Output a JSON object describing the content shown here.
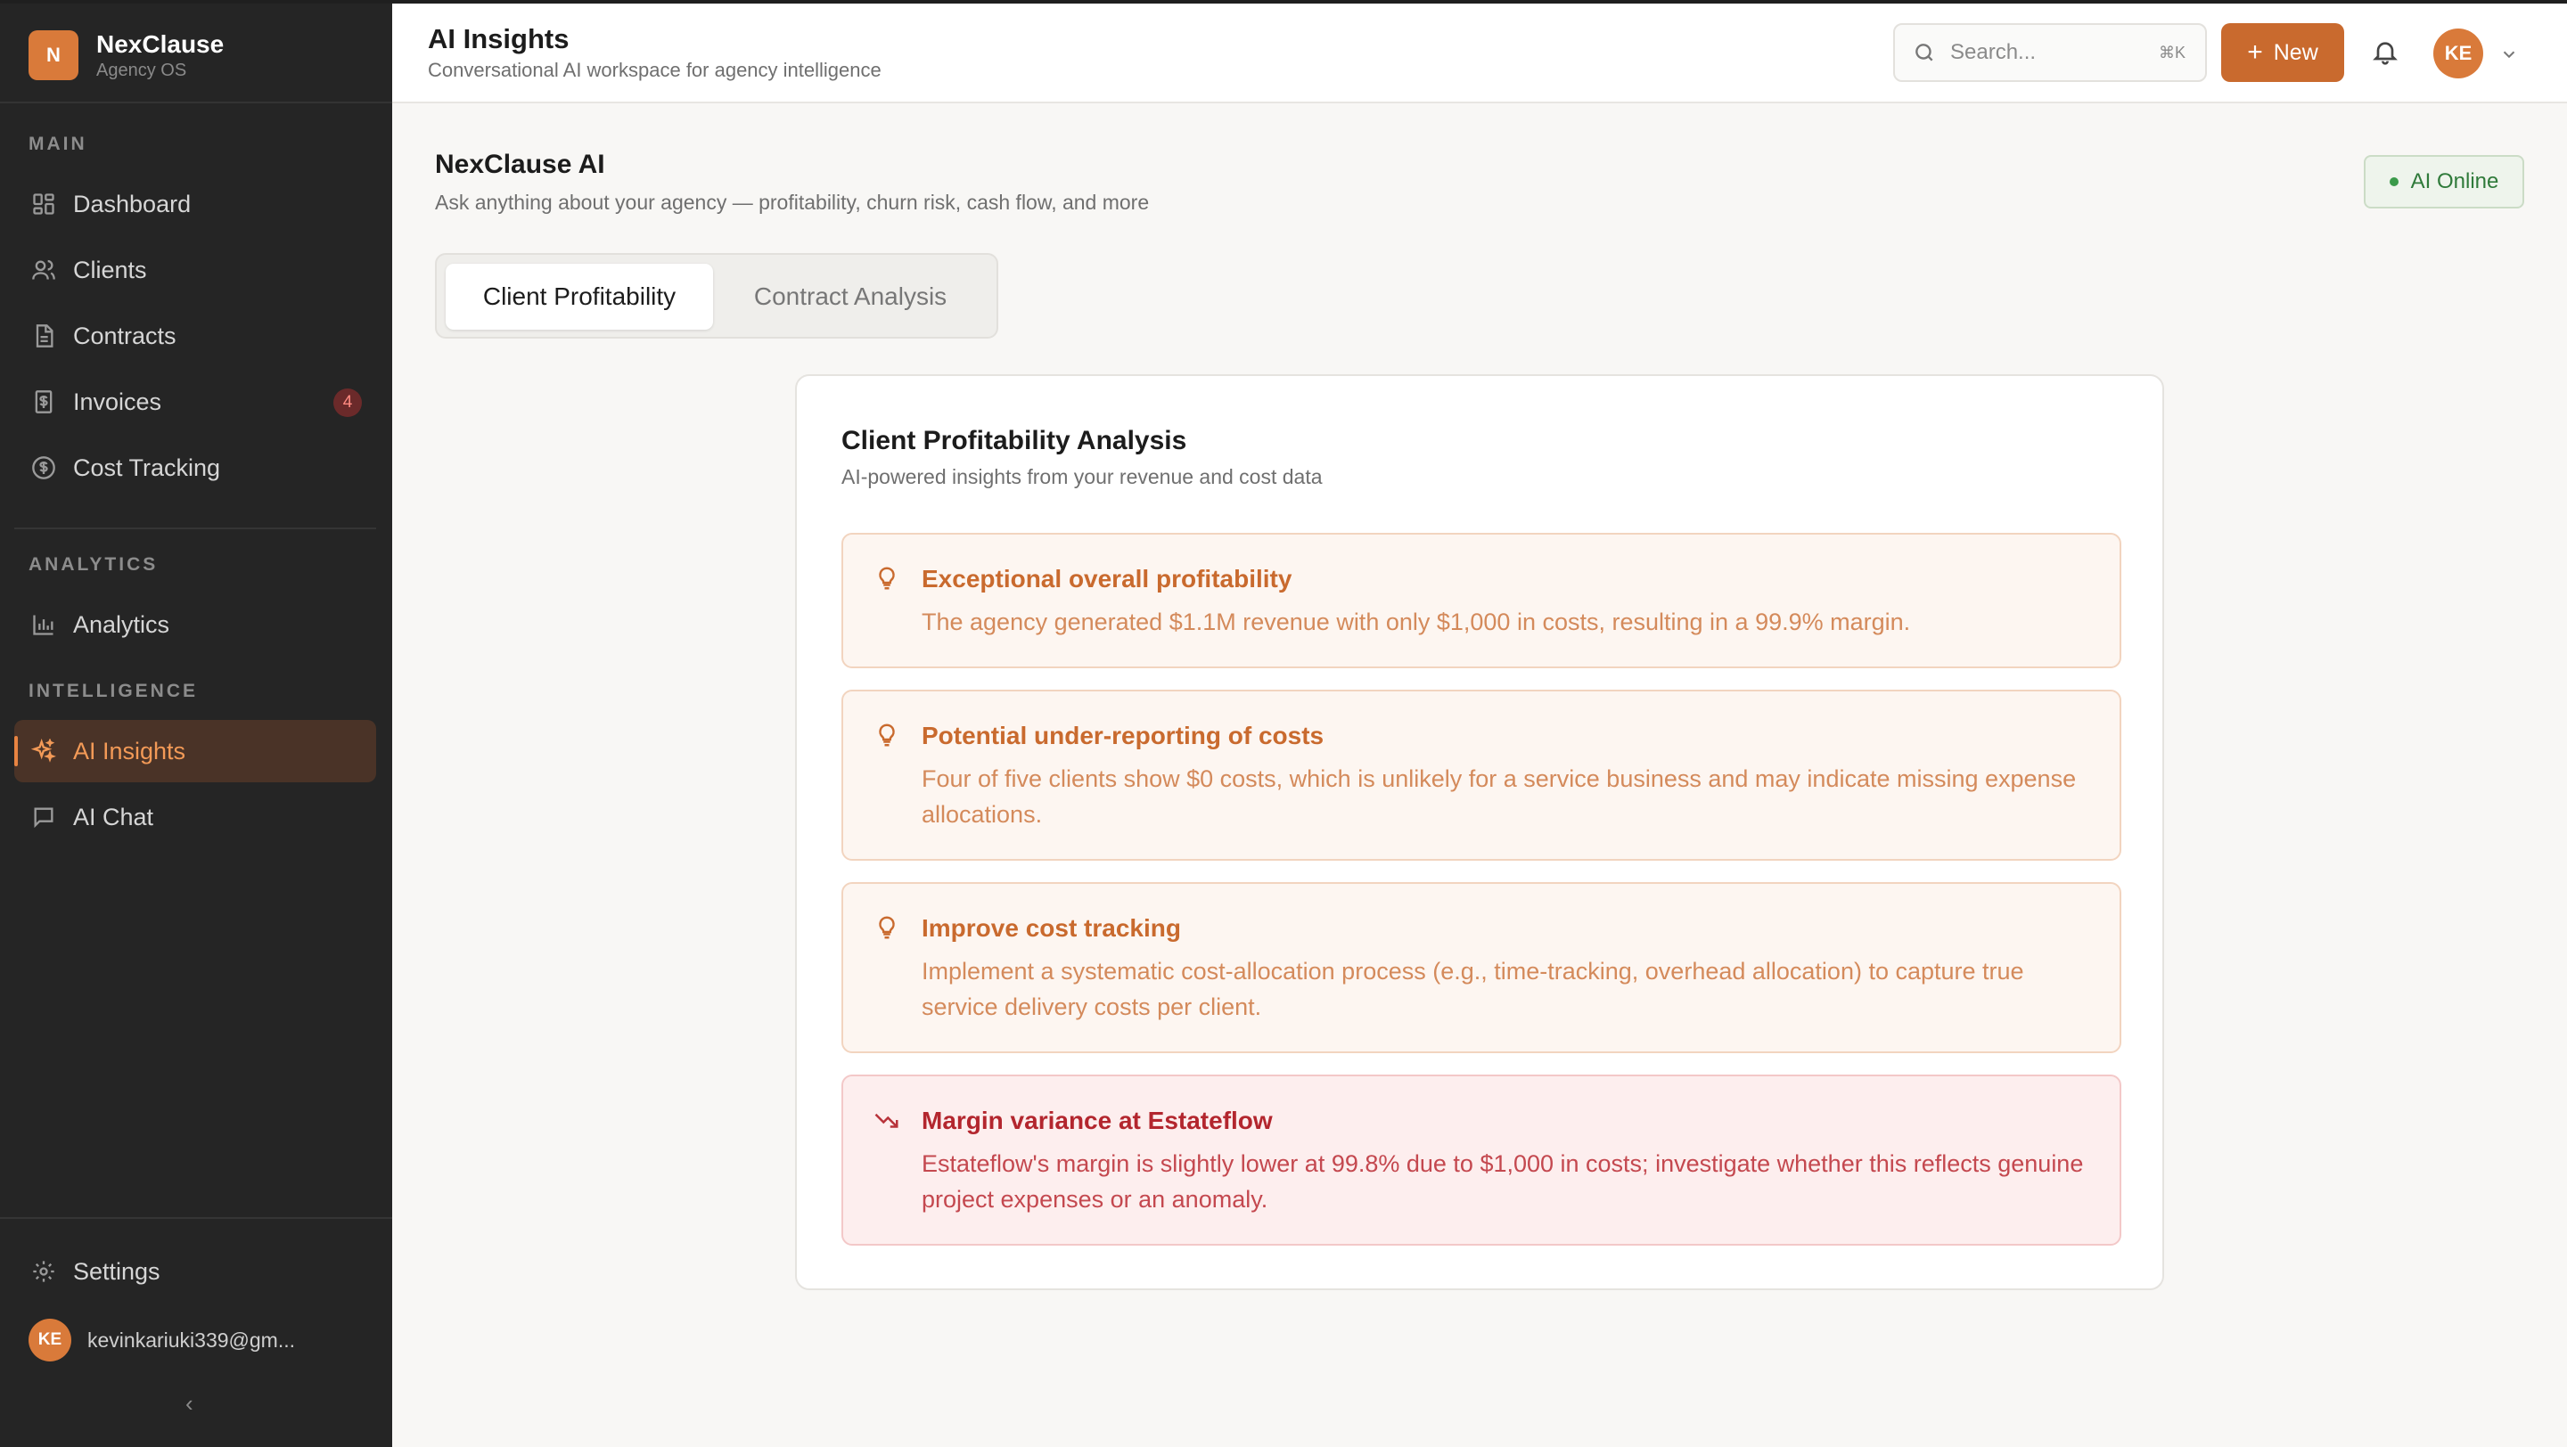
{
  "sidebar": {
    "brand": {
      "logo_letter": "N",
      "name": "NexClause",
      "subtitle": "Agency OS"
    },
    "sections": {
      "main": "MAIN",
      "analytics": "ANALYTICS",
      "intelligence": "INTELLIGENCE"
    },
    "items": {
      "dashboard": "Dashboard",
      "clients": "Clients",
      "contracts": "Contracts",
      "invoices": "Invoices",
      "invoices_badge": "4",
      "cost_tracking": "Cost Tracking",
      "analytics": "Analytics",
      "ai_insights": "AI Insights",
      "ai_chat": "AI Chat",
      "settings": "Settings"
    },
    "user": {
      "initials": "KE",
      "email": "kevinkariuki339@gm..."
    },
    "collapse_glyph": "‹"
  },
  "header": {
    "title": "AI Insights",
    "subtitle": "Conversational AI workspace for agency intelligence",
    "search_placeholder": "Search...",
    "search_shortcut": "⌘K",
    "new_label": "New",
    "avatar_initials": "KE"
  },
  "main": {
    "title": "NexClause AI",
    "subtitle": "Ask anything about your agency — profitability, churn risk, cash flow, and more",
    "status": "AI Online",
    "tabs": [
      "Client Profitability",
      "Contract Analysis"
    ],
    "card": {
      "title": "Client Profitability Analysis",
      "subtitle": "AI-powered insights from your revenue and cost data",
      "insights": [
        {
          "icon": "lightbulb-icon",
          "title": "Exceptional overall profitability",
          "body": "The agency generated $1.1M revenue with only $1,000 in costs, resulting in a 99.9% margin."
        },
        {
          "icon": "lightbulb-icon",
          "title": "Potential under-reporting of costs",
          "body": "Four of five clients show $0 costs, which is unlikely for a service business and may indicate missing expense allocations."
        },
        {
          "icon": "lightbulb-icon",
          "title": "Improve cost tracking",
          "body": "Implement a systematic cost-allocation process (e.g., time-tracking, overhead allocation) to capture true service delivery costs per client."
        },
        {
          "icon": "trending-down-icon",
          "title": "Margin variance at Estateflow",
          "body": "Estateflow's margin is slightly lower at 99.8% due to $1,000 in costs; investigate whether this reflects genuine project expenses or an anomaly."
        }
      ]
    }
  },
  "colors": {
    "accent": "#c96a2e",
    "sidebar_bg": "#252525",
    "active_nav_bg": "#4a3327",
    "risk": "#b3262e",
    "online": "#2f7a3a"
  }
}
